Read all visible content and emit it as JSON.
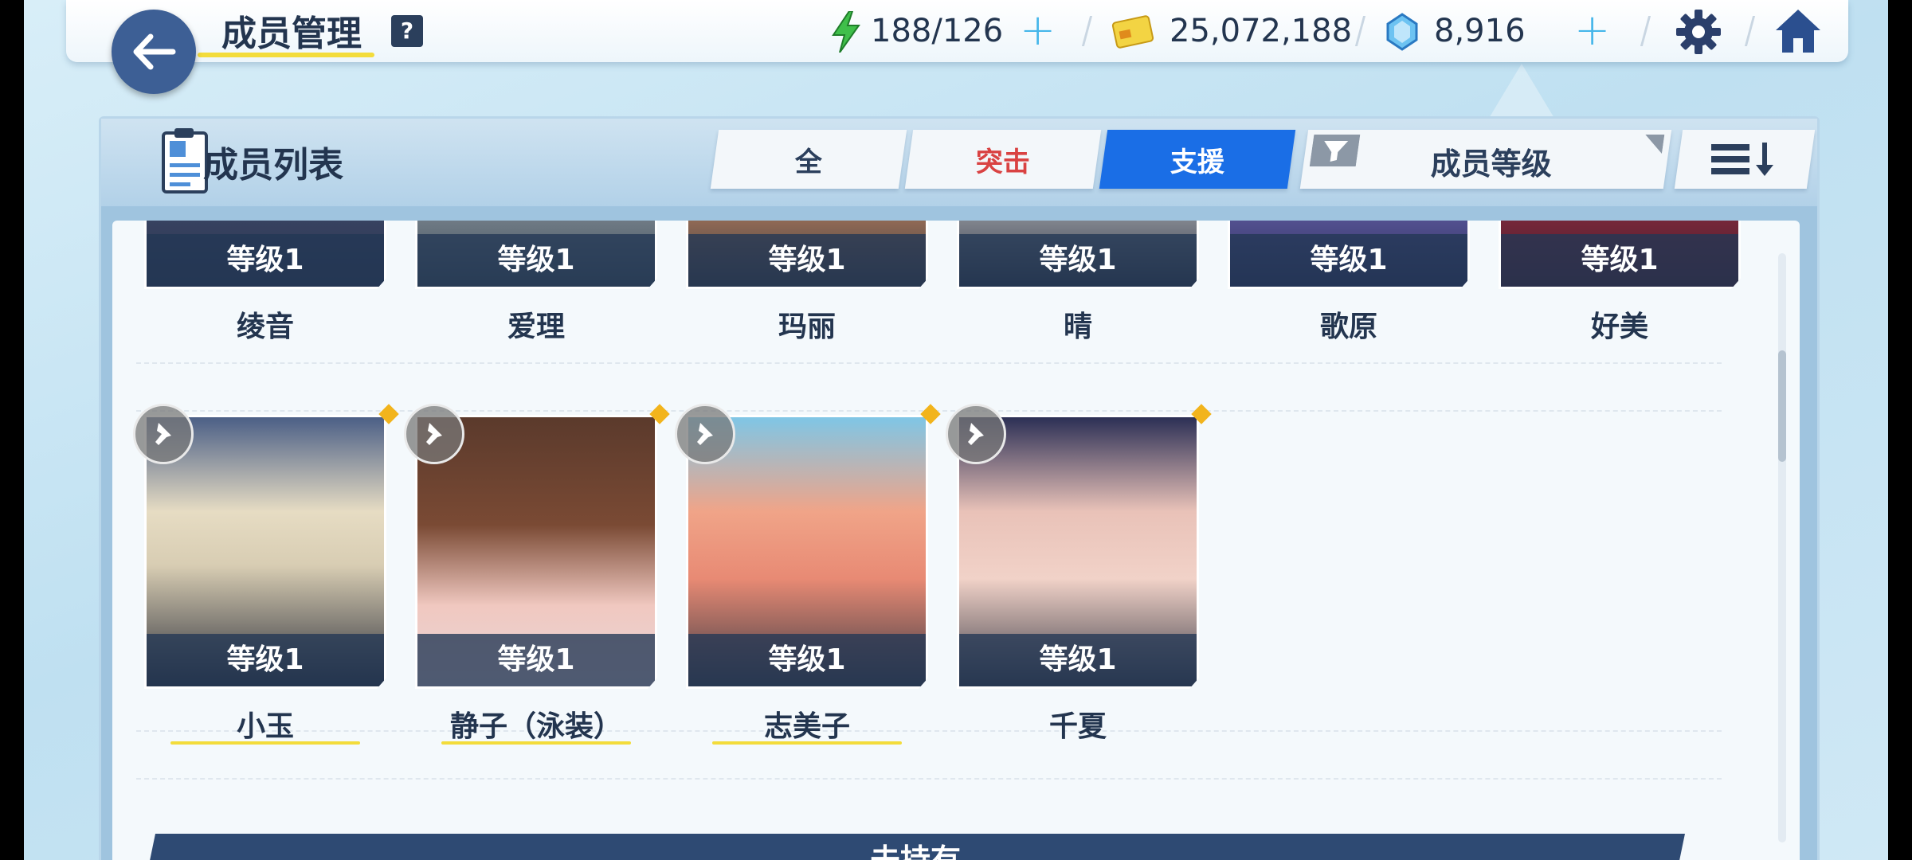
{
  "header": {
    "title": "成员管理",
    "help_label": "?",
    "ap": "188/126",
    "credits": "25,072,188",
    "pyroxene": "8,916"
  },
  "panel": {
    "title": "成员列表",
    "tabs": [
      {
        "label": "全",
        "active": false
      },
      {
        "label": "突击",
        "active": false
      },
      {
        "label": "支援",
        "active": true
      }
    ],
    "sort_label": "成员等级"
  },
  "row1": [
    {
      "name": "绫音",
      "level": "等级1"
    },
    {
      "name": "爱理",
      "level": "等级1"
    },
    {
      "name": "玛丽",
      "level": "等级1"
    },
    {
      "name": "晴",
      "level": "等级1"
    },
    {
      "name": "歌原",
      "level": "等级1"
    },
    {
      "name": "好美",
      "level": "等级1"
    }
  ],
  "row2": [
    {
      "name": "小玉",
      "level": "等级1"
    },
    {
      "name": "静子（泳装）",
      "level": "等级1"
    },
    {
      "name": "志美子",
      "level": "等级1"
    },
    {
      "name": "千夏",
      "level": "等级1"
    }
  ],
  "section_not_owned": "未持有",
  "colors": {
    "accent_blue": "#1a6ee6",
    "assault_red": "#d94242",
    "navy": "#2e4a73",
    "highlight_yellow": "#f3dc3b"
  },
  "icons": [
    "back-arrow-icon",
    "help-icon",
    "ap-lightning-icon",
    "credit-card-icon",
    "pyroxene-gem-icon",
    "gear-icon",
    "home-icon",
    "member-list-icon",
    "filter-icon",
    "sort-order-icon",
    "pin-icon"
  ]
}
